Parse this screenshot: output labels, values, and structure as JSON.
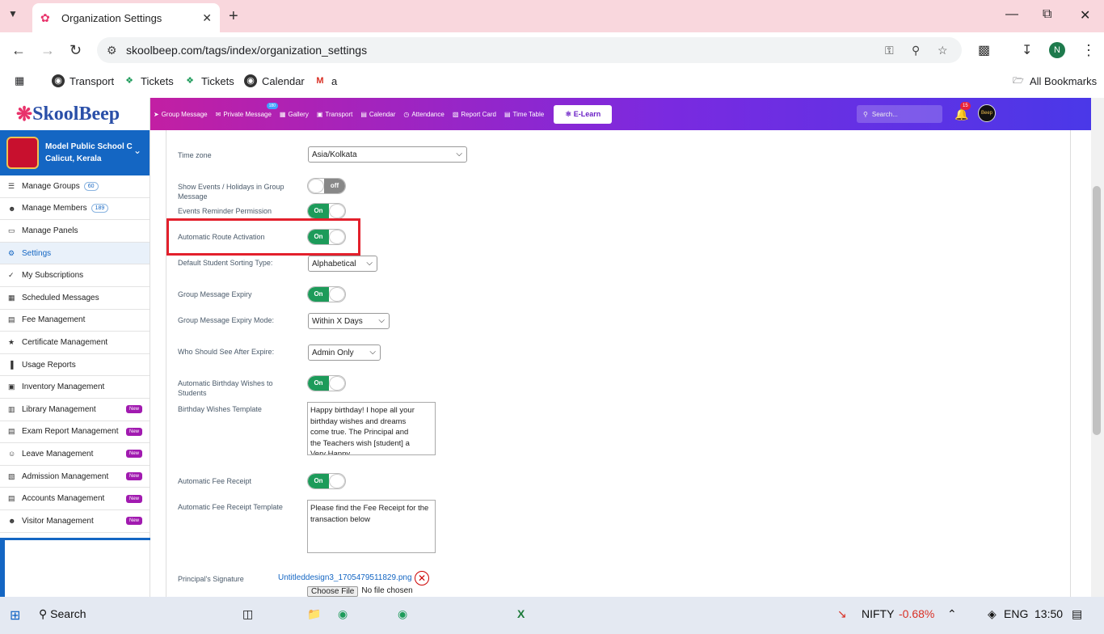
{
  "browser": {
    "tab_title": "Organization Settings",
    "url": "skoolbeep.com/tags/index/organization_settings",
    "bookmarks": [
      "Transport",
      "Tickets",
      "Tickets",
      "Calendar",
      "a"
    ],
    "all_bookmarks": "All Bookmarks",
    "profile_initial": "N"
  },
  "app": {
    "logo": "SkoolBeep",
    "school_name": "Model Public School C",
    "school_location": "Calicut, Kerala",
    "topnav": [
      "Group Message",
      "Private Message",
      "Gallery",
      "Transport",
      "Calendar",
      "Attendance",
      "Report Card",
      "Time Table"
    ],
    "private_badge": "180",
    "elearn": "E-Learn",
    "search_placeholder": "Search...",
    "notif_count": "15",
    "avatar_text": "Beep"
  },
  "sidebar": [
    {
      "label": "Manage Groups",
      "count": "60",
      "icon": "list-icon"
    },
    {
      "label": "Manage Members",
      "count": "189",
      "icon": "users-icon"
    },
    {
      "label": "Manage Panels",
      "icon": "monitor-icon"
    },
    {
      "label": "Settings",
      "icon": "gear-icon",
      "active": true
    },
    {
      "label": "My Subscriptions",
      "icon": "check-icon"
    },
    {
      "label": "Scheduled Messages",
      "icon": "calendar-icon"
    },
    {
      "label": "Fee Management",
      "icon": "doc-icon"
    },
    {
      "label": "Certificate Management",
      "icon": "award-icon"
    },
    {
      "label": "Usage Reports",
      "icon": "chart-icon"
    },
    {
      "label": "Inventory Management",
      "icon": "box-icon"
    },
    {
      "label": "Library Management",
      "icon": "book-icon",
      "new": "New"
    },
    {
      "label": "Exam Report Management",
      "icon": "doc-icon",
      "new": "New"
    },
    {
      "label": "Leave Management",
      "icon": "person-icon",
      "new": "New"
    },
    {
      "label": "Admission Management",
      "icon": "id-icon",
      "new": "New"
    },
    {
      "label": "Accounts Management",
      "icon": "doc-icon",
      "new": "New"
    },
    {
      "label": "Visitor Management",
      "icon": "users-icon",
      "new": "New"
    }
  ],
  "settings": {
    "time_zone_label": "Time zone",
    "time_zone_value": "Asia/Kolkata",
    "show_events_label": "Show Events / Holidays in Group Message",
    "off_text": "off",
    "on_text": "On",
    "events_reminder_label": "Events Reminder Permission",
    "auto_route_label": "Automatic Route Activation",
    "sorting_label": "Default Student Sorting Type:",
    "sorting_value": "Alphabetical",
    "gm_expiry_label": "Group Message Expiry",
    "gm_expiry_mode_label": "Group Message Expiry Mode:",
    "gm_expiry_mode_value": "Within X Days",
    "who_see_label": "Who Should See After Expire:",
    "who_see_value": "Admin Only",
    "birthday_label": "Automatic Birthday Wishes to Students",
    "birthday_template_label": "Birthday Wishes Template",
    "birthday_template": "Happy birthday! I hope all your birthday wishes and dreams come true. The Principal and the Teachers wish [student] a Very Happy",
    "fee_receipt_label": "Automatic Fee Receipt",
    "fee_template_label": "Automatic Fee Receipt Template",
    "fee_template": "Please find the Fee Receipt for the transaction below",
    "signature_label": "Principal's Signature",
    "signature_file": "Untitleddesign3_1705479511829.png",
    "choose_file": "Choose File",
    "no_file": "No file chosen"
  },
  "taskbar": {
    "search": "Search",
    "nifty": "NIFTY",
    "nifty_change": "-0.68%",
    "lang": "ENG",
    "time": "13:50"
  }
}
